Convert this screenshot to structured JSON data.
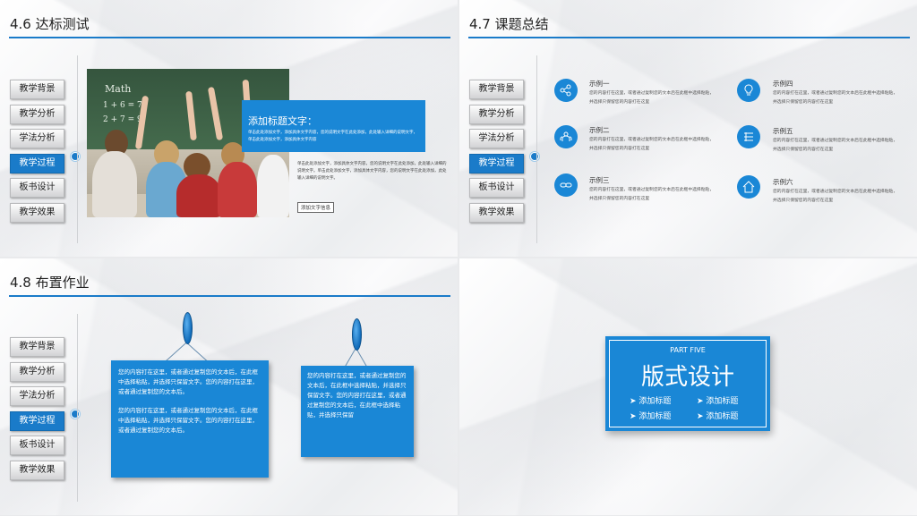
{
  "menu": [
    "教学背景",
    "教学分析",
    "学法分析",
    "教学过程",
    "板书设计",
    "教学效果"
  ],
  "panel1": {
    "title": "4.6 达标测试",
    "board_text": [
      "Math",
      "1 + 6 = 7",
      "2 + 7 = 9"
    ],
    "box_title": "添加标题文字：",
    "box_text": "单击此处添加文字，添加具体文字内容，您的说明文字在此处添加，此处输入详细的说明文字，单击此处添加文字，添加具体文字内容",
    "body_text": "单击此处添加文字，添加具体文字内容，您的说明文字在此处添加，此处输入详细的说明文字。单击此处添加文字，添加具体文字内容，您的说明文字在此处添加，此处输入详细的说明文字。",
    "button": "添加文字信息"
  },
  "panel2": {
    "title": "4.7 课题总结",
    "items": [
      {
        "title": "示例一",
        "icon": "share-icon",
        "text": "您的内容打在这里，或者通过复制您的文本后在此框中选择粘贴，并选择只保留您的内容打在这里"
      },
      {
        "title": "示例二",
        "icon": "people-icon",
        "text": "您的内容打在这里，或者通过复制您的文本后在此框中选择粘贴，并选择只保留您的内容打在这里"
      },
      {
        "title": "示例三",
        "icon": "link-icon",
        "text": "您的内容打在这里，或者通过复制您的文本后在此框中选择粘贴，并选择只保留您的内容打在这里"
      },
      {
        "title": "示例四",
        "icon": "bulb-icon",
        "text": "您的内容打在这里，或者通过复制您的文本后在此框中选择粘贴，并选择只保留您的内容打在这里"
      },
      {
        "title": "示例五",
        "icon": "list-icon",
        "text": "您的内容打在这里，或者通过复制您的文本后在此框中选择粘贴，并选择只保留您的内容打在这里"
      },
      {
        "title": "示例六",
        "icon": "home-icon",
        "text": "您的内容打在这里，或者通过复制您的文本后在此框中选择粘贴，并选择只保留您的内容打在这里"
      }
    ]
  },
  "panel3": {
    "title": "4.8 布置作业",
    "note1": [
      "您的内容打在这里，或者通过复制您的文本后，在此框中选择粘贴，并选择只保留文字。您的内容打在这里，或者通过复制您的文本后。",
      "您的内容打在这里，或者通过复制您的文本后，在此框中选择粘贴，并选择只保留文字。您的内容打在这里，或者通过复制您的文本后。"
    ],
    "note2": "您的内容打在这里，或者通过复制您的文本后，在此框中选择粘贴，并选择只保留文字。您的内容打在这里，或者通过复制您的文本后，在此框中选择粘贴，并选择只保留"
  },
  "panel4": {
    "part_label": "PART FIVE",
    "title": "版式设计",
    "links": [
      "添加标题",
      "添加标题",
      "添加标题",
      "添加标题"
    ]
  },
  "colors": {
    "accent": "#1a87d6",
    "accent_dark": "#1a7bc9"
  }
}
